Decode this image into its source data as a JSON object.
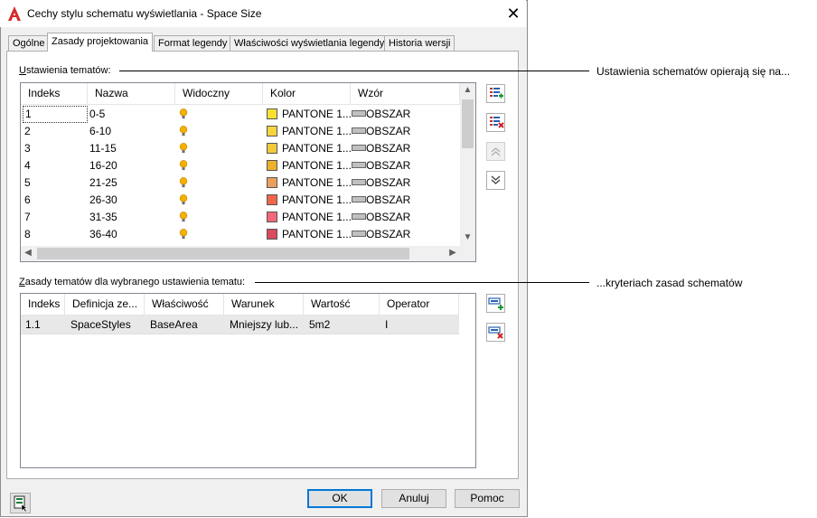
{
  "window": {
    "title": "Cechy stylu schematu wyświetlania - Space Size"
  },
  "tabs": [
    {
      "label": "Ogólne",
      "active": false
    },
    {
      "label": "Zasady projektowania",
      "active": true
    },
    {
      "label": "Format legendy",
      "active": false
    },
    {
      "label": "Właściwości wyświetlania legendy",
      "active": false
    },
    {
      "label": "Historia wersji",
      "active": false
    }
  ],
  "theme_settings": {
    "label_prefix": "U",
    "label_rest": "stawienia tematów:",
    "columns": [
      "Indeks",
      "Nazwa",
      "Widoczny",
      "Kolor",
      "Wzór"
    ],
    "rows": [
      {
        "index": "1",
        "name": "0-5",
        "color_name": "PANTONE 1...",
        "color": "#f7e030",
        "pattern": "OBSZAR"
      },
      {
        "index": "2",
        "name": "6-10",
        "color_name": "PANTONE 1...",
        "color": "#f5d53e",
        "pattern": "OBSZAR"
      },
      {
        "index": "3",
        "name": "11-15",
        "color_name": "PANTONE 1...",
        "color": "#f2c93a",
        "pattern": "OBSZAR"
      },
      {
        "index": "4",
        "name": "16-20",
        "color_name": "PANTONE 1...",
        "color": "#ecb12a",
        "pattern": "OBSZAR"
      },
      {
        "index": "5",
        "name": "21-25",
        "color_name": "PANTONE 1...",
        "color": "#e9a05c",
        "pattern": "OBSZAR"
      },
      {
        "index": "6",
        "name": "26-30",
        "color_name": "PANTONE 1...",
        "color": "#f06848",
        "pattern": "OBSZAR"
      },
      {
        "index": "7",
        "name": "31-35",
        "color_name": "PANTONE 1...",
        "color": "#f2687a",
        "pattern": "OBSZAR"
      },
      {
        "index": "8",
        "name": "36-40",
        "color_name": "PANTONE 1...",
        "color": "#d94b5e",
        "pattern": "OBSZAR"
      }
    ]
  },
  "theme_rules": {
    "label_prefix": "Z",
    "label_rest": "asady tematów dla wybranego ustawienia tematu:",
    "columns": [
      "Indeks",
      "Definicja ze...",
      "Właściwość",
      "Warunek",
      "Wartość",
      "Operator"
    ],
    "rows": [
      {
        "index": "1.1",
        "definition": "SpaceStyles",
        "property": "BaseArea",
        "condition": "Mniejszy lub...",
        "value": "5m2",
        "operator": "I"
      }
    ]
  },
  "callouts": {
    "top": "Ustawienia schematów opierają się na...",
    "bottom": "...kryteriach zasad schematów"
  },
  "buttons": {
    "ok": "OK",
    "cancel": "Anuluj",
    "help": "Pomoc"
  },
  "colors": {
    "selection": "#0078d7",
    "accent": "#0078d7"
  }
}
